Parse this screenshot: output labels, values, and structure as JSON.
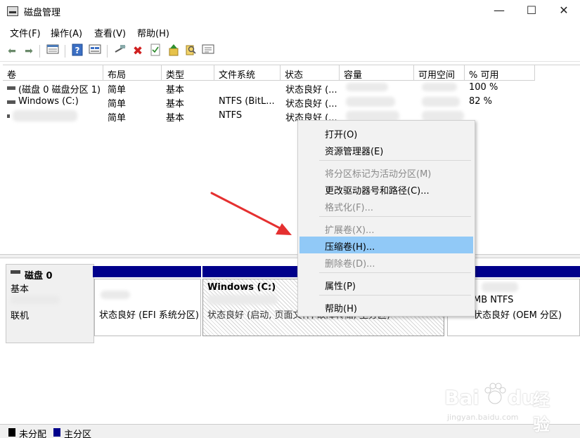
{
  "window": {
    "title": "磁盘管理",
    "minimize": "—",
    "maximize": "☐",
    "close": "✕"
  },
  "menubar": [
    "文件(F)",
    "操作(A)",
    "查看(V)",
    "帮助(H)"
  ],
  "toolbar": {
    "icons": [
      "back-icon",
      "forward-icon",
      "volume-list-icon",
      "help-icon",
      "disk-list-icon",
      "connect-icon",
      "delete-icon",
      "check-icon",
      "up-icon",
      "search-icon",
      "properties-icon"
    ]
  },
  "table": {
    "headers": [
      "卷",
      "布局",
      "类型",
      "文件系统",
      "状态",
      "容量",
      "可用空间",
      "% 可用"
    ],
    "rows": [
      {
        "volume": "(磁盘 0 磁盘分区 1)",
        "layout": "简单",
        "type": "基本",
        "fs": "",
        "status": "状态良好 (...",
        "percent": "100 %"
      },
      {
        "volume": "Windows (C:)",
        "layout": "简单",
        "type": "基本",
        "fs": "NTFS (BitL...",
        "status": "状态良好 (...",
        "percent": "82 %"
      },
      {
        "volume": "",
        "layout": "简单",
        "type": "基本",
        "fs": "NTFS",
        "status": "状态良好 (...",
        "percent": ""
      }
    ]
  },
  "disk": {
    "name": "磁盘 0",
    "kind": "基本",
    "state": "联机",
    "partitions": [
      {
        "title": "",
        "status": "状态良好 (EFI 系统分区)"
      },
      {
        "title": "Windows  (C:)",
        "status": "状态良好 (启动, 页面文件, 故障转储, 主分区)"
      },
      {
        "title": "MB NTFS",
        "status": "状态良好 (OEM 分区)"
      }
    ]
  },
  "legend": {
    "unallocated": "未分配",
    "primary": "主分区",
    "unallocated_color": "#000000",
    "primary_color": "#00008b"
  },
  "context_menu": {
    "items": [
      {
        "label": "打开(O)",
        "enabled": true
      },
      {
        "label": "资源管理器(E)",
        "enabled": true
      },
      {
        "label": "将分区标记为活动分区(M)",
        "enabled": false
      },
      {
        "label": "更改驱动器号和路径(C)...",
        "enabled": true
      },
      {
        "label": "格式化(F)...",
        "enabled": false
      },
      {
        "label": "扩展卷(X)...",
        "enabled": false
      },
      {
        "label": "压缩卷(H)...",
        "enabled": true,
        "highlighted": true
      },
      {
        "label": "删除卷(D)...",
        "enabled": false
      },
      {
        "label": "属性(P)",
        "enabled": true
      },
      {
        "label": "帮助(H)",
        "enabled": true
      }
    ]
  },
  "watermark": {
    "brand": "Bai",
    "brand2": "du",
    "suffix": "经验",
    "url": "jingyan.baidu.com"
  },
  "colors": {
    "highlight": "#91c9f7",
    "partition_bar": "#00008b",
    "annotation_arrow": "#e53030"
  }
}
